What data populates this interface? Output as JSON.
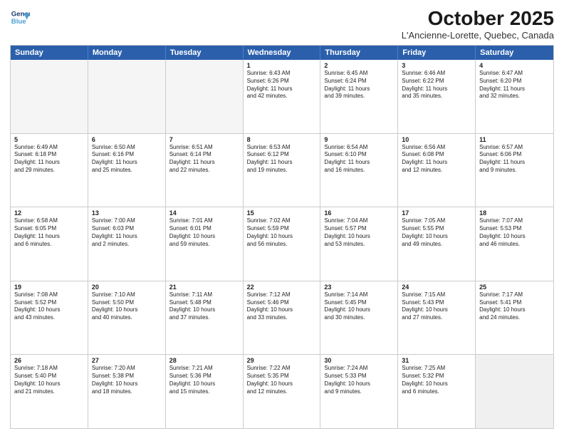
{
  "header": {
    "logo_line1": "General",
    "logo_line2": "Blue",
    "title": "October 2025",
    "subtitle": "L'Ancienne-Lorette, Quebec, Canada"
  },
  "weekdays": [
    "Sunday",
    "Monday",
    "Tuesday",
    "Wednesday",
    "Thursday",
    "Friday",
    "Saturday"
  ],
  "rows": [
    [
      {
        "day": "",
        "text": "",
        "empty": true
      },
      {
        "day": "",
        "text": "",
        "empty": true
      },
      {
        "day": "",
        "text": "",
        "empty": true
      },
      {
        "day": "1",
        "text": "Sunrise: 6:43 AM\nSunset: 6:26 PM\nDaylight: 11 hours\nand 42 minutes."
      },
      {
        "day": "2",
        "text": "Sunrise: 6:45 AM\nSunset: 6:24 PM\nDaylight: 11 hours\nand 39 minutes."
      },
      {
        "day": "3",
        "text": "Sunrise: 6:46 AM\nSunset: 6:22 PM\nDaylight: 11 hours\nand 35 minutes."
      },
      {
        "day": "4",
        "text": "Sunrise: 6:47 AM\nSunset: 6:20 PM\nDaylight: 11 hours\nand 32 minutes."
      }
    ],
    [
      {
        "day": "5",
        "text": "Sunrise: 6:49 AM\nSunset: 6:18 PM\nDaylight: 11 hours\nand 29 minutes."
      },
      {
        "day": "6",
        "text": "Sunrise: 6:50 AM\nSunset: 6:16 PM\nDaylight: 11 hours\nand 25 minutes."
      },
      {
        "day": "7",
        "text": "Sunrise: 6:51 AM\nSunset: 6:14 PM\nDaylight: 11 hours\nand 22 minutes."
      },
      {
        "day": "8",
        "text": "Sunrise: 6:53 AM\nSunset: 6:12 PM\nDaylight: 11 hours\nand 19 minutes."
      },
      {
        "day": "9",
        "text": "Sunrise: 6:54 AM\nSunset: 6:10 PM\nDaylight: 11 hours\nand 16 minutes."
      },
      {
        "day": "10",
        "text": "Sunrise: 6:56 AM\nSunset: 6:08 PM\nDaylight: 11 hours\nand 12 minutes."
      },
      {
        "day": "11",
        "text": "Sunrise: 6:57 AM\nSunset: 6:06 PM\nDaylight: 11 hours\nand 9 minutes."
      }
    ],
    [
      {
        "day": "12",
        "text": "Sunrise: 6:58 AM\nSunset: 6:05 PM\nDaylight: 11 hours\nand 6 minutes."
      },
      {
        "day": "13",
        "text": "Sunrise: 7:00 AM\nSunset: 6:03 PM\nDaylight: 11 hours\nand 2 minutes."
      },
      {
        "day": "14",
        "text": "Sunrise: 7:01 AM\nSunset: 6:01 PM\nDaylight: 10 hours\nand 59 minutes."
      },
      {
        "day": "15",
        "text": "Sunrise: 7:02 AM\nSunset: 5:59 PM\nDaylight: 10 hours\nand 56 minutes."
      },
      {
        "day": "16",
        "text": "Sunrise: 7:04 AM\nSunset: 5:57 PM\nDaylight: 10 hours\nand 53 minutes."
      },
      {
        "day": "17",
        "text": "Sunrise: 7:05 AM\nSunset: 5:55 PM\nDaylight: 10 hours\nand 49 minutes."
      },
      {
        "day": "18",
        "text": "Sunrise: 7:07 AM\nSunset: 5:53 PM\nDaylight: 10 hours\nand 46 minutes."
      }
    ],
    [
      {
        "day": "19",
        "text": "Sunrise: 7:08 AM\nSunset: 5:52 PM\nDaylight: 10 hours\nand 43 minutes."
      },
      {
        "day": "20",
        "text": "Sunrise: 7:10 AM\nSunset: 5:50 PM\nDaylight: 10 hours\nand 40 minutes."
      },
      {
        "day": "21",
        "text": "Sunrise: 7:11 AM\nSunset: 5:48 PM\nDaylight: 10 hours\nand 37 minutes."
      },
      {
        "day": "22",
        "text": "Sunrise: 7:12 AM\nSunset: 5:46 PM\nDaylight: 10 hours\nand 33 minutes."
      },
      {
        "day": "23",
        "text": "Sunrise: 7:14 AM\nSunset: 5:45 PM\nDaylight: 10 hours\nand 30 minutes."
      },
      {
        "day": "24",
        "text": "Sunrise: 7:15 AM\nSunset: 5:43 PM\nDaylight: 10 hours\nand 27 minutes."
      },
      {
        "day": "25",
        "text": "Sunrise: 7:17 AM\nSunset: 5:41 PM\nDaylight: 10 hours\nand 24 minutes."
      }
    ],
    [
      {
        "day": "26",
        "text": "Sunrise: 7:18 AM\nSunset: 5:40 PM\nDaylight: 10 hours\nand 21 minutes."
      },
      {
        "day": "27",
        "text": "Sunrise: 7:20 AM\nSunset: 5:38 PM\nDaylight: 10 hours\nand 18 minutes."
      },
      {
        "day": "28",
        "text": "Sunrise: 7:21 AM\nSunset: 5:36 PM\nDaylight: 10 hours\nand 15 minutes."
      },
      {
        "day": "29",
        "text": "Sunrise: 7:22 AM\nSunset: 5:35 PM\nDaylight: 10 hours\nand 12 minutes."
      },
      {
        "day": "30",
        "text": "Sunrise: 7:24 AM\nSunset: 5:33 PM\nDaylight: 10 hours\nand 9 minutes."
      },
      {
        "day": "31",
        "text": "Sunrise: 7:25 AM\nSunset: 5:32 PM\nDaylight: 10 hours\nand 6 minutes."
      },
      {
        "day": "",
        "text": "",
        "empty": true,
        "shaded": true
      }
    ]
  ]
}
